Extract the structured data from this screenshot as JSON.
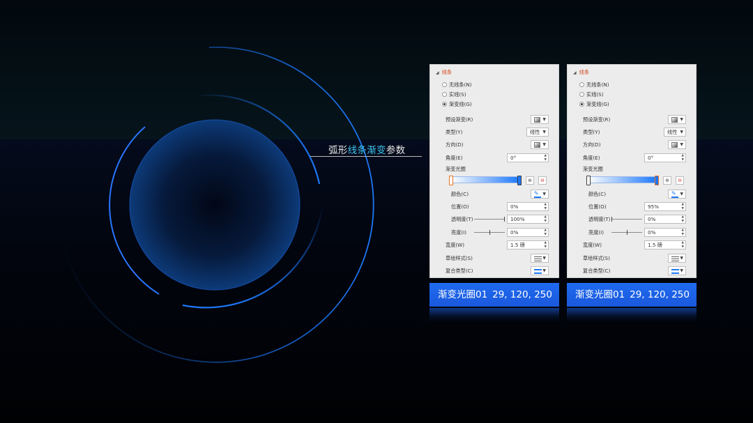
{
  "caption": {
    "prefix": "弧形",
    "highlight": "线条渐变",
    "suffix": "参数"
  },
  "colors": {
    "accent": "#1d78fa",
    "caption_highlight": "#3fc4f0",
    "section_title": "#d04a1f",
    "tag_bg": "#1f6bf0"
  },
  "panels": [
    {
      "section_title": "线条",
      "radio_none": "无线条(N)",
      "radio_solid": "实线(S)",
      "radio_gradient": "渐变线(G)",
      "selected_radio": "gradient",
      "preset_label": "预设渐变(R)",
      "type_label": "类型(Y)",
      "type_value": "线性",
      "direction_label": "方向(D)",
      "angle_label": "角度(E)",
      "angle_value": "0°",
      "stops_label": "渐变光圈",
      "selected_stop": "left",
      "color_label": "颜色(C)",
      "position_label": "位置(O)",
      "position_value": "0%",
      "transparency_label": "透明度(T)",
      "transparency_value": "100%",
      "transparency_level": 1.0,
      "brightness_label": "亮度(I)",
      "brightness_value": "0%",
      "brightness_level": 0.5,
      "width_label": "宽度(W)",
      "width_value": "1.5 磅",
      "sketch_label": "草绘样式(S)",
      "compound_label": "复合类型(C)",
      "tag_name": "渐变光圈01",
      "tag_rgb": "29, 120, 250"
    },
    {
      "section_title": "线条",
      "radio_none": "无线条(N)",
      "radio_solid": "实线(S)",
      "radio_gradient": "渐变线(G)",
      "selected_radio": "gradient",
      "preset_label": "预设渐变(R)",
      "type_label": "类型(Y)",
      "type_value": "线性",
      "direction_label": "方向(D)",
      "angle_label": "角度(E)",
      "angle_value": "0°",
      "stops_label": "渐变光圈",
      "selected_stop": "right",
      "color_label": "颜色(C)",
      "position_label": "位置(O)",
      "position_value": "95%",
      "transparency_label": "透明度(T)",
      "transparency_value": "0%",
      "transparency_level": 0.0,
      "brightness_label": "亮度(I)",
      "brightness_value": "0%",
      "brightness_level": 0.5,
      "width_label": "宽度(W)",
      "width_value": "1.5 磅",
      "sketch_label": "草绘样式(S)",
      "compound_label": "复合类型(C)",
      "tag_name": "渐变光圈01",
      "tag_rgb": "29, 120, 250"
    }
  ]
}
